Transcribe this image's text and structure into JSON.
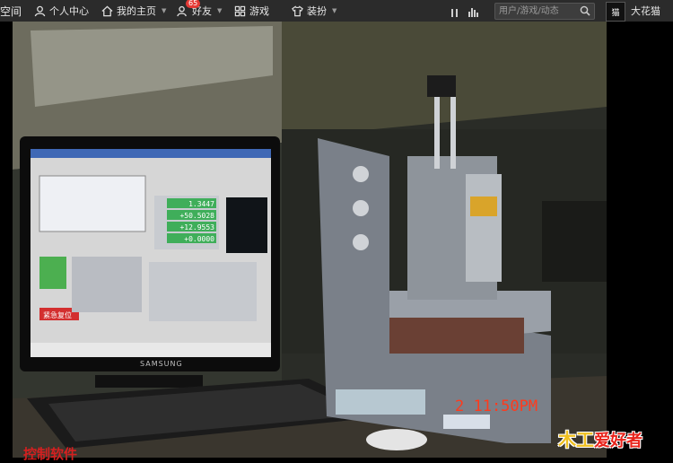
{
  "nav": {
    "space": "空间",
    "personal_center": "个人中心",
    "my_homepage": "我的主页",
    "friends": "好友",
    "friends_badge": "65",
    "games": "游戏",
    "dressup": "装扮",
    "search_placeholder": "用户/游戏/动态",
    "avatar_text": "猫",
    "username": "大花猫"
  },
  "photo": {
    "timestamp": "2  11:50PM",
    "monitor_brand": "SAMSUNG",
    "screen_readouts": [
      "1.3447",
      "+50.5028",
      "+12.9553",
      "+0.0000"
    ],
    "estop_label": "紧急复位",
    "caption": "控制软件",
    "watermark": "爱好者",
    "watermark_mark": "木工"
  },
  "colors": {
    "topbar_bg": "#2b2b2b",
    "caption_red": "#d42020",
    "stamp_orange": "#ff3a1c",
    "screen_green": "#3fae5a"
  }
}
